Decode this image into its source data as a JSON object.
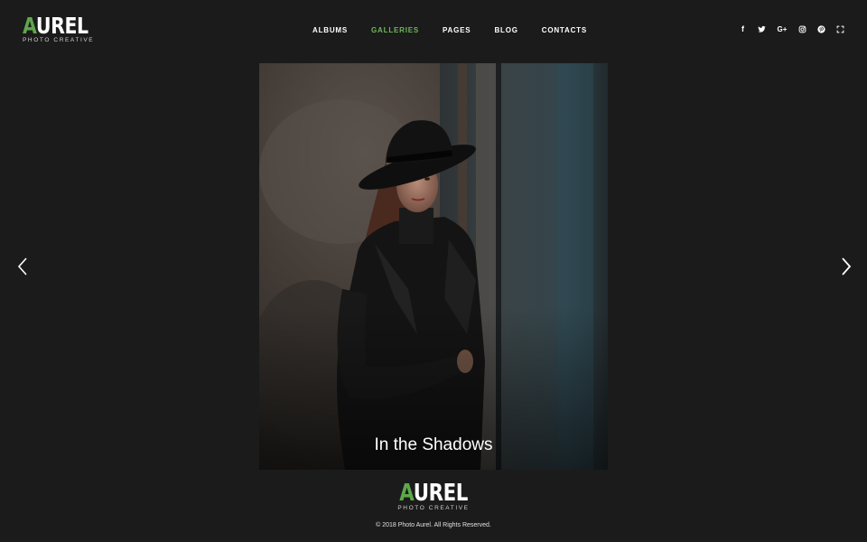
{
  "brand": {
    "first_letter": "A",
    "rest": "UREL",
    "tagline": "PHOTO CREATIVE"
  },
  "nav": {
    "items": [
      {
        "label": "ALBUMS",
        "active": false
      },
      {
        "label": "GALLERIES",
        "active": true
      },
      {
        "label": "PAGES",
        "active": false
      },
      {
        "label": "BLOG",
        "active": false
      },
      {
        "label": "CONTACTS",
        "active": false
      }
    ]
  },
  "social": [
    "facebook-icon",
    "twitter-icon",
    "google-plus-icon",
    "instagram-icon",
    "pinterest-icon",
    "fullscreen-icon"
  ],
  "social_glyphs": {
    "facebook": "f",
    "google_plus": "G+"
  },
  "gallery": {
    "caption": "In the Shadows"
  },
  "footer": {
    "brand_first": "A",
    "brand_rest": "UREL",
    "tagline": "PHOTO CREATIVE",
    "copyright": "© 2018 Photo Aurel. All Rights Reserved."
  },
  "colors": {
    "accent": "#5ea84a",
    "background": "#1b1b1b",
    "nav_active": "#6fb65b"
  }
}
